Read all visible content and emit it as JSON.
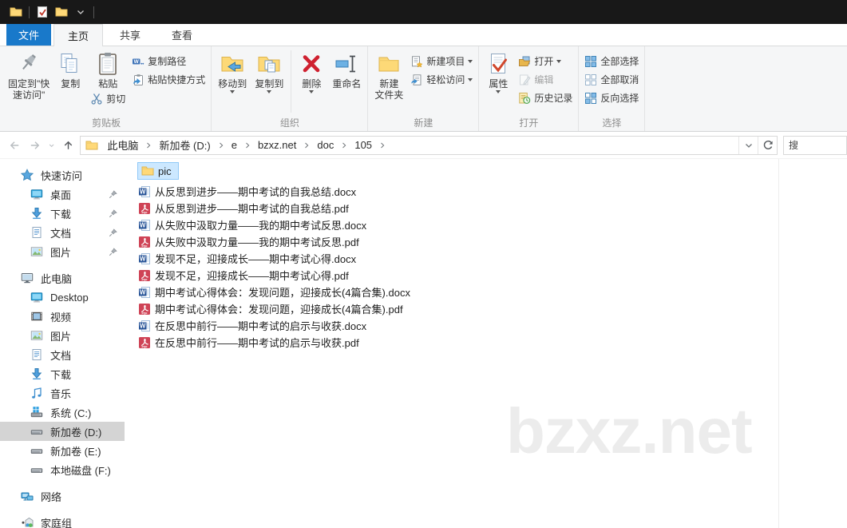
{
  "window": {
    "qat_icons": [
      "folder-icon",
      "separator",
      "properties-check-icon",
      "folder-icon",
      "chevron-down-icon",
      "separator"
    ]
  },
  "tabs": {
    "file": {
      "label": "文件"
    },
    "items": [
      {
        "label": "主页",
        "name": "tab-home",
        "active": true
      },
      {
        "label": "共享",
        "name": "tab-share",
        "active": false
      },
      {
        "label": "查看",
        "name": "tab-view",
        "active": false
      }
    ]
  },
  "ribbon": {
    "groups": [
      {
        "label": "剪贴板",
        "items": [
          {
            "kind": "large",
            "name": "pin-to-quick-access-button",
            "icon": "pin-large-icon",
            "lines": [
              "固定到\"快",
              "速访问\""
            ]
          },
          {
            "kind": "large",
            "name": "copy-button",
            "icon": "copy-icon",
            "lines": [
              "复制"
            ]
          },
          {
            "kind": "stack",
            "items": [
              {
                "kind": "large",
                "name": "paste-button",
                "icon": "paste-icon",
                "lines": [
                  "粘贴"
                ]
              },
              {
                "kind": "small",
                "name": "cut-button",
                "icon": "cut-icon",
                "label": "剪切"
              }
            ]
          },
          {
            "kind": "col",
            "items": [
              {
                "kind": "small",
                "name": "copy-path-button",
                "icon": "copy-path-icon",
                "label": "复制路径"
              },
              {
                "kind": "small",
                "name": "paste-shortcut-button",
                "icon": "paste-shortcut-icon",
                "label": "粘贴快捷方式"
              }
            ]
          }
        ]
      },
      {
        "label": "组织",
        "items": [
          {
            "kind": "large",
            "name": "move-to-button",
            "icon": "move-to-icon",
            "lines": [
              "移动到"
            ],
            "caret": true
          },
          {
            "kind": "large",
            "name": "copy-to-button",
            "icon": "copy-to-icon",
            "lines": [
              "复制到"
            ],
            "caret": true
          },
          {
            "kind": "vsep"
          },
          {
            "kind": "large",
            "name": "delete-button",
            "icon": "delete-icon",
            "lines": [
              "删除"
            ],
            "caret": true
          },
          {
            "kind": "large",
            "name": "rename-button",
            "icon": "rename-icon",
            "lines": [
              "重命名"
            ]
          }
        ]
      },
      {
        "label": "新建",
        "items": [
          {
            "kind": "large",
            "name": "new-folder-button",
            "icon": "new-folder-icon",
            "lines": [
              "新建",
              "文件夹"
            ]
          },
          {
            "kind": "col",
            "items": [
              {
                "kind": "small",
                "name": "new-item-button",
                "icon": "new-item-icon",
                "label": "新建项目",
                "caret": true
              },
              {
                "kind": "small",
                "name": "easy-access-button",
                "icon": "easy-access-icon",
                "label": "轻松访问",
                "caret": true
              }
            ]
          }
        ]
      },
      {
        "label": "打开",
        "items": [
          {
            "kind": "large",
            "name": "properties-button",
            "icon": "properties-icon",
            "lines": [
              "属性"
            ],
            "caret": true
          },
          {
            "kind": "col",
            "items": [
              {
                "kind": "small",
                "name": "open-button",
                "icon": "open-icon",
                "label": "打开",
                "caret": true
              },
              {
                "kind": "small",
                "name": "edit-button",
                "icon": "edit-icon",
                "label": "编辑",
                "disabled": true
              },
              {
                "kind": "small",
                "name": "history-button",
                "icon": "history-icon",
                "label": "历史记录"
              }
            ]
          }
        ]
      },
      {
        "label": "选择",
        "items": [
          {
            "kind": "col",
            "items": [
              {
                "kind": "small",
                "name": "select-all-button",
                "icon": "select-all-icon",
                "label": "全部选择"
              },
              {
                "kind": "small",
                "name": "select-none-button",
                "icon": "select-none-icon",
                "label": "全部取消"
              },
              {
                "kind": "small",
                "name": "invert-selection-button",
                "icon": "invert-selection-icon",
                "label": "反向选择"
              }
            ]
          }
        ]
      }
    ]
  },
  "address_bar": {
    "crumbs": [
      "此电脑",
      "新加卷 (D:)",
      "e",
      "bzxz.net",
      "doc",
      "105"
    ],
    "search_text": "搜"
  },
  "sidebar": {
    "sections": [
      {
        "label": "快速访问",
        "name": "sidebar-section-quick-access",
        "icon": "quick-access-star-icon",
        "items": [
          {
            "label": "桌面",
            "name": "sidebar-item-desktop",
            "icon": "desktop-icon",
            "pinned": true
          },
          {
            "label": "下载",
            "name": "sidebar-item-downloads",
            "icon": "download-icon",
            "pinned": true
          },
          {
            "label": "文档",
            "name": "sidebar-item-documents",
            "icon": "documents-icon",
            "pinned": true
          },
          {
            "label": "图片",
            "name": "sidebar-item-pictures",
            "icon": "pictures-icon",
            "pinned": true
          }
        ]
      },
      {
        "label": "此电脑",
        "name": "sidebar-section-this-pc",
        "icon": "computer-icon",
        "items": [
          {
            "label": "Desktop",
            "name": "sidebar-item-desktop-folder",
            "icon": "desktop-icon"
          },
          {
            "label": "视频",
            "name": "sidebar-item-videos",
            "icon": "videos-icon"
          },
          {
            "label": "图片",
            "name": "sidebar-item-pictures-pc",
            "icon": "pictures-icon"
          },
          {
            "label": "文档",
            "name": "sidebar-item-documents-pc",
            "icon": "documents-icon"
          },
          {
            "label": "下载",
            "name": "sidebar-item-downloads-pc",
            "icon": "download-icon"
          },
          {
            "label": "音乐",
            "name": "sidebar-item-music",
            "icon": "music-icon"
          },
          {
            "label": "系统 (C:)",
            "name": "sidebar-item-drive-c",
            "icon": "system-drive-icon"
          },
          {
            "label": "新加卷 (D:)",
            "name": "sidebar-item-drive-d",
            "icon": "drive-icon",
            "selected": true
          },
          {
            "label": "新加卷 (E:)",
            "name": "sidebar-item-drive-e",
            "icon": "drive-icon"
          },
          {
            "label": "本地磁盘 (F:)",
            "name": "sidebar-item-drive-f",
            "icon": "drive-icon"
          }
        ]
      },
      {
        "label": "网络",
        "name": "sidebar-section-network",
        "icon": "network-icon",
        "items": []
      },
      {
        "label": "家庭组",
        "name": "sidebar-section-homegroup",
        "icon": "homegroup-icon",
        "items": []
      }
    ]
  },
  "file_list": {
    "selected_folder": {
      "label": "pic",
      "icon": "folder-icon"
    },
    "files": [
      {
        "name": "从反思到进步——期中考试的自我总结.docx",
        "icon": "word-icon"
      },
      {
        "name": "从反思到进步——期中考试的自我总结.pdf",
        "icon": "pdf-icon"
      },
      {
        "name": "从失败中汲取力量——我的期中考试反思.docx",
        "icon": "word-icon"
      },
      {
        "name": "从失败中汲取力量——我的期中考试反思.pdf",
        "icon": "pdf-icon"
      },
      {
        "name": "发现不足，迎接成长——期中考试心得.docx",
        "icon": "word-icon"
      },
      {
        "name": "发现不足，迎接成长——期中考试心得.pdf",
        "icon": "pdf-icon"
      },
      {
        "name": "期中考试心得体会：发现问题，迎接成长(4篇合集).docx",
        "icon": "word-icon"
      },
      {
        "name": "期中考试心得体会：发现问题，迎接成长(4篇合集).pdf",
        "icon": "pdf-icon"
      },
      {
        "name": "在反思中前行——期中考试的启示与收获.docx",
        "icon": "word-icon"
      },
      {
        "name": "在反思中前行——期中考试的启示与收获.pdf",
        "icon": "pdf-icon"
      }
    ]
  },
  "watermark": {
    "text": "bzxz.net"
  }
}
